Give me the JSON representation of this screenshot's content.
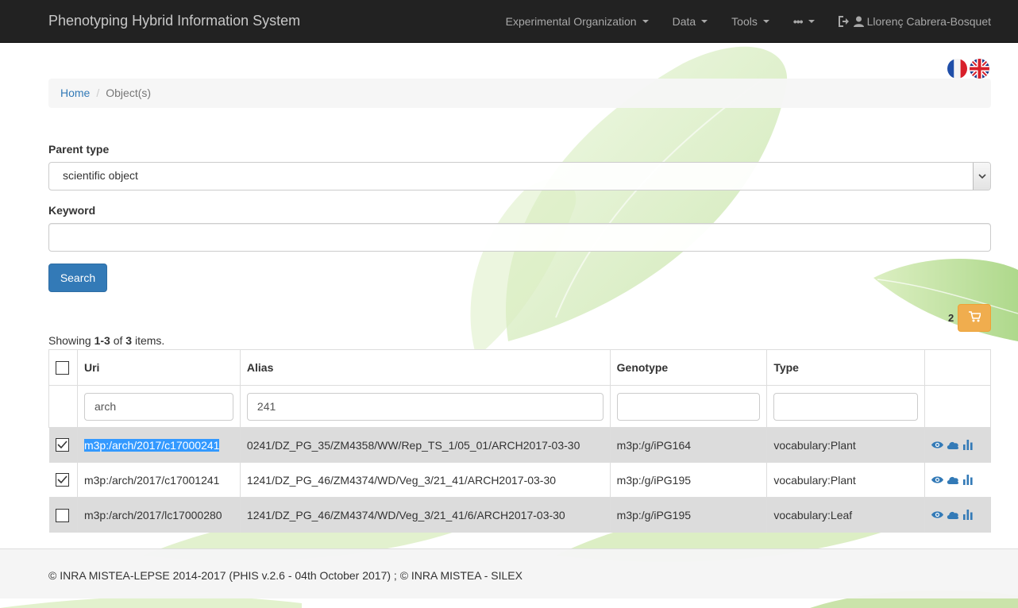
{
  "app": {
    "title": "Phenotyping Hybrid Information System"
  },
  "nav": {
    "items": [
      {
        "label": "Experimental Organization"
      },
      {
        "label": "Data"
      },
      {
        "label": "Tools"
      },
      {
        "label": "•••"
      }
    ],
    "user": "Llorenç Cabrera-Bosquet"
  },
  "breadcrumb": {
    "home": "Home",
    "current": "Object(s)"
  },
  "form": {
    "parent_type_label": "Parent type",
    "parent_type_value": "scientific object",
    "keyword_label": "Keyword",
    "keyword_value": "",
    "search_label": "Search"
  },
  "cart": {
    "count": "2"
  },
  "summary": {
    "prefix": "Showing ",
    "range": "1-3",
    "of": " of ",
    "total": "3",
    "suffix": " items."
  },
  "table": {
    "headers": {
      "uri": "Uri",
      "alias": "Alias",
      "genotype": "Genotype",
      "type": "Type"
    },
    "filters": {
      "uri": "arch",
      "alias": "241",
      "genotype": "",
      "type": ""
    },
    "rows": [
      {
        "checked": true,
        "uri": "m3p:/arch/2017/c17000241",
        "alias": "0241/DZ_PG_35/ZM4358/WW/Rep_TS_1/05_01/ARCH2017-03-30",
        "genotype": "m3p:/g/iPG164",
        "type": "vocabulary:Plant"
      },
      {
        "checked": true,
        "uri": "m3p:/arch/2017/c17001241",
        "alias": "1241/DZ_PG_46/ZM4374/WD/Veg_3/21_41/ARCH2017-03-30",
        "genotype": "m3p:/g/iPG195",
        "type": "vocabulary:Plant"
      },
      {
        "checked": false,
        "uri": "m3p:/arch/2017/lc17000280",
        "alias": "1241/DZ_PG_46/ZM4374/WD/Veg_3/21_41/6/ARCH2017-03-30",
        "genotype": "m3p:/g/iPG195",
        "type": "vocabulary:Leaf"
      }
    ]
  },
  "footer": {
    "text": "© INRA MISTEA-LEPSE 2014-2017 (PHIS v.2.6 - 04th October 2017) ; © INRA MISTEA - SILEX"
  },
  "colors": {
    "navbar": "#222222",
    "primary": "#337ab7",
    "warning": "#f0ad4e",
    "selection": "#3399ff"
  },
  "icons": {
    "logout": "sign-out-icon",
    "user": "user-icon",
    "cart": "cart-icon",
    "view": "eye-icon",
    "cloud": "cloud-icon",
    "chart": "bar-chart-icon"
  }
}
